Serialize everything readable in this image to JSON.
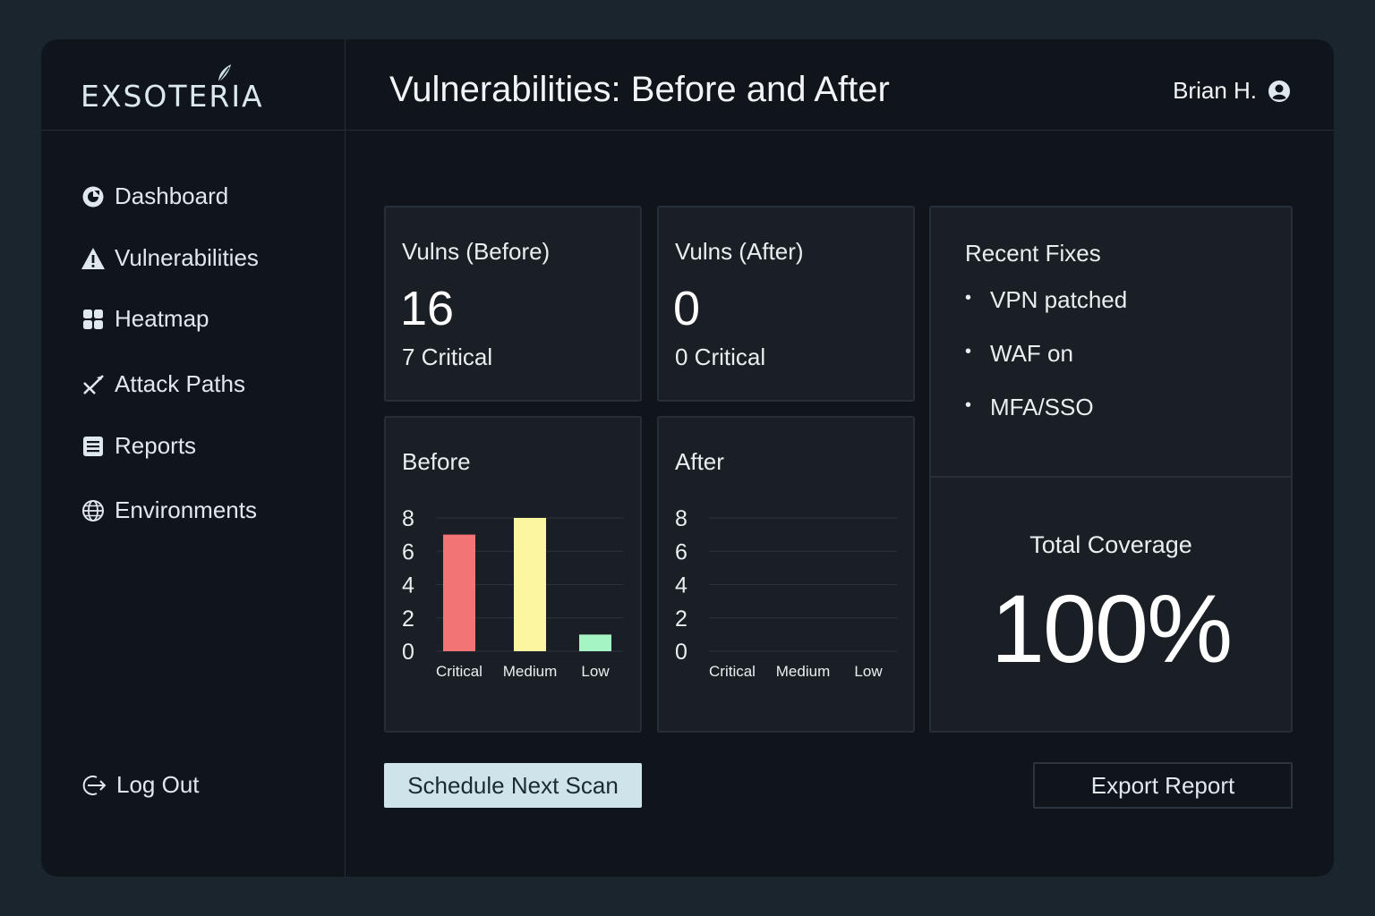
{
  "app": {
    "logo_text": "EXSOTERIA",
    "title": "Vulnerabilities: Before and After"
  },
  "user": {
    "name": "Brian H.",
    "icon": "user-circle-icon"
  },
  "sidebar": {
    "items": [
      {
        "label": "Dashboard",
        "icon": "dashboard-icon"
      },
      {
        "label": "Vulnerabilities",
        "icon": "warning-icon"
      },
      {
        "label": "Heatmap",
        "icon": "grid-icon"
      },
      {
        "label": "Attack Paths",
        "icon": "attack-path-icon"
      },
      {
        "label": "Reports",
        "icon": "reports-icon"
      },
      {
        "label": "Environments",
        "icon": "globe-icon"
      }
    ],
    "logout": {
      "label": "Log Out",
      "icon": "logout-icon"
    }
  },
  "cards": {
    "before": {
      "title": "Vulns (Before)",
      "value": "16",
      "sub": "7 Critical"
    },
    "after": {
      "title": "Vulns (After)",
      "value": "0",
      "sub": "0 Critical"
    }
  },
  "recent_fixes": {
    "title": "Recent Fixes",
    "items": [
      "VPN patched",
      "WAF on",
      "MFA/SSO"
    ]
  },
  "coverage": {
    "label": "Total Coverage",
    "value": "100%"
  },
  "buttons": {
    "schedule": "Schedule Next Scan",
    "export": "Export Report"
  },
  "colors": {
    "critical": "#f27474",
    "medium": "#fdf6a0",
    "low": "#a4f4c4",
    "accent_button": "#cfe3ea"
  },
  "chart_data": [
    {
      "type": "bar",
      "title": "Before",
      "categories": [
        "Critical",
        "Medium",
        "Low"
      ],
      "values": [
        7,
        8,
        1
      ],
      "yticks": [
        0,
        2,
        4,
        6,
        8
      ],
      "ylim": [
        0,
        8
      ],
      "grid": true,
      "colors": [
        "#f27474",
        "#fdf6a0",
        "#a4f4c4"
      ]
    },
    {
      "type": "bar",
      "title": "After",
      "categories": [
        "Critical",
        "Medium",
        "Low"
      ],
      "values": [
        0,
        0,
        0
      ],
      "yticks": [
        0,
        2,
        4,
        6,
        8
      ],
      "ylim": [
        0,
        8
      ],
      "grid": true,
      "colors": [
        "#f27474",
        "#fdf6a0",
        "#a4f4c4"
      ]
    }
  ]
}
